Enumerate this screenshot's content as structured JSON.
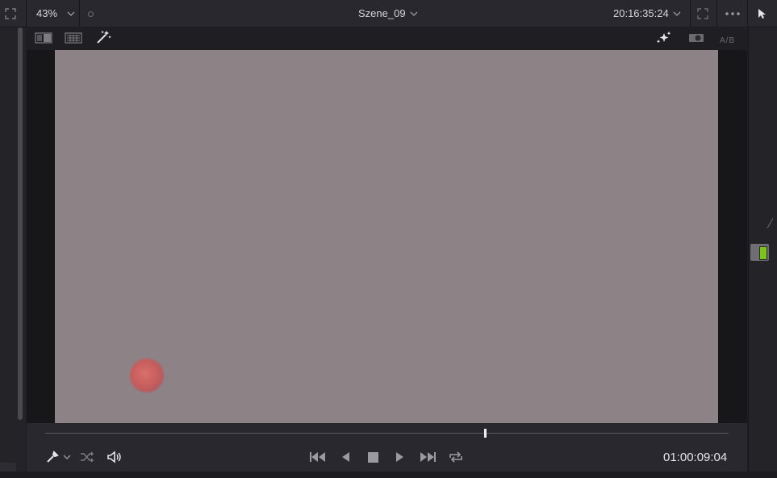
{
  "viewer": {
    "zoom": "43%",
    "clip_name": "Szene_09",
    "source_timecode": "20:16:35:24",
    "ab_label": "A/B"
  },
  "transport": {
    "timecode": "01:00:09:04",
    "playhead_fraction": 0.643
  },
  "colors": {
    "image_bg": "#8d8387",
    "node_green": "#7ec31a",
    "panel": "#28282e"
  }
}
